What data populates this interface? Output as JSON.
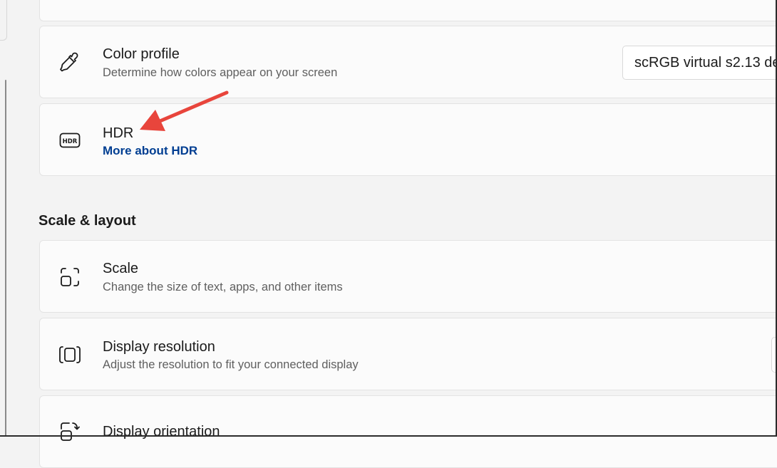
{
  "settings": {
    "color_profile": {
      "title": "Color profile",
      "description": "Determine how colors appear on your screen",
      "selected_value": "scRGB virtual s2.13 de"
    },
    "hdr": {
      "title": "HDR",
      "link": "More about HDR"
    },
    "section_scale_layout": "Scale & layout",
    "scale": {
      "title": "Scale",
      "description": "Change the size of text, apps, and other items"
    },
    "display_resolution": {
      "title": "Display resolution",
      "description": "Adjust the resolution to fit your connected display"
    },
    "display_orientation": {
      "title": "Display orientation"
    }
  },
  "colors": {
    "background": "#f3f3f3",
    "card": "#fbfbfb",
    "link": "#003e92",
    "annotation_arrow": "#e8453c"
  },
  "icons": [
    "eyedropper-icon",
    "hdr-icon",
    "scale-icon",
    "display-resolution-icon",
    "display-orientation-icon"
  ]
}
